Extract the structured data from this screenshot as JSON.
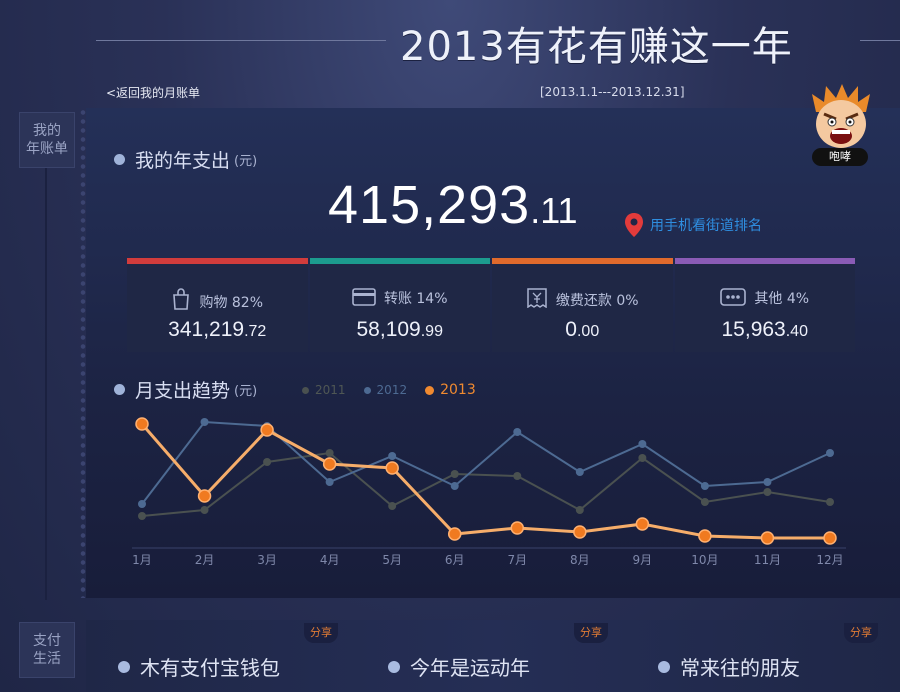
{
  "header": {
    "title": "2013有花有赚这一年",
    "back_link": "<返回我的月账单",
    "date_range": "[2013.1.1---2013.12.31]"
  },
  "rail": {
    "annual_tab": "我的\n年账单",
    "life_tab": "支付\n生活"
  },
  "mascot": {
    "badge": "咆哮",
    "icon": "angry-face-icon"
  },
  "spending": {
    "title": "我的年支出",
    "unit": "(元)",
    "total_int": "415,293",
    "total_dec": ".11",
    "rank_link": "用手机看街道排名"
  },
  "categories": [
    {
      "label": "购物 82%",
      "int": "341,219",
      "dec": ".72",
      "color": "#d23c3c",
      "icon": "shopping-bag-icon"
    },
    {
      "label": "转账 14%",
      "int": "58,109",
      "dec": ".99",
      "color": "#1c9b8e",
      "icon": "card-icon"
    },
    {
      "label": "缴费还款 0%",
      "int": "0",
      "dec": ".00",
      "color": "#e06a2c",
      "icon": "bill-icon"
    },
    {
      "label": "其他 4%",
      "int": "15,963",
      "dec": ".40",
      "color": "#8a5bb5",
      "icon": "more-icon"
    }
  ],
  "trend": {
    "title": "月支出趋势",
    "unit": "(元)"
  },
  "chart_data": {
    "type": "line",
    "categories": [
      "1月",
      "2月",
      "3月",
      "4月",
      "5月",
      "6月",
      "7月",
      "8月",
      "9月",
      "10月",
      "11月",
      "12月"
    ],
    "series": [
      {
        "name": "2011",
        "color": "#4a5150",
        "values": [
          32,
          38,
          86,
          95,
          42,
          74,
          72,
          38,
          90,
          46,
          56,
          46
        ]
      },
      {
        "name": "2012",
        "color": "#4d6a92",
        "values": [
          44,
          126,
          122,
          66,
          92,
          62,
          116,
          76,
          104,
          62,
          66,
          95
        ]
      },
      {
        "name": "2013",
        "color": "#f08a30",
        "values": [
          124,
          52,
          118,
          84,
          80,
          14,
          20,
          16,
          24,
          12,
          10,
          10
        ]
      }
    ],
    "ylim": [
      0,
      140
    ],
    "grid": false,
    "legend": "top-left"
  },
  "life": {
    "share_label": "分享",
    "items": [
      "木有支付宝钱包",
      "今年是运动年",
      "常来往的朋友"
    ]
  }
}
